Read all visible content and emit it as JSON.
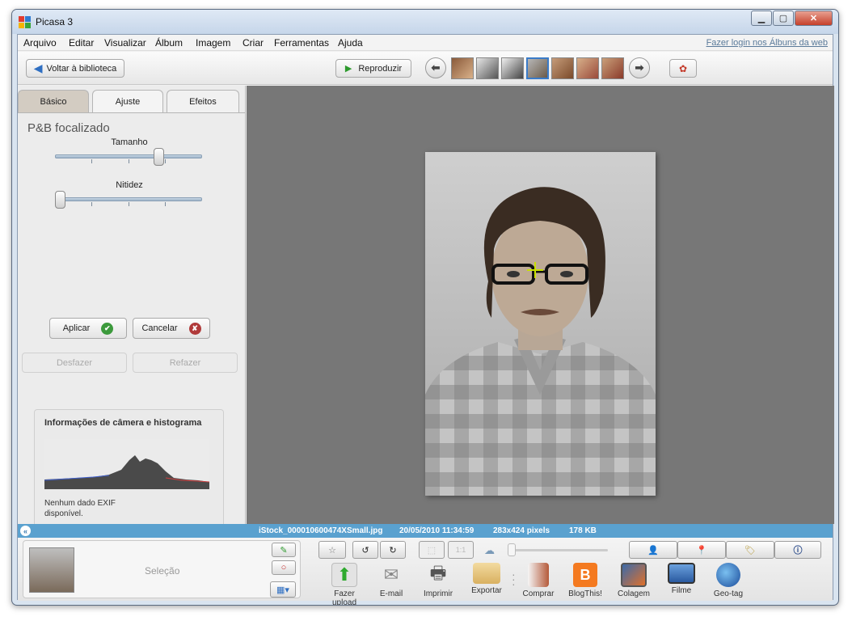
{
  "window": {
    "title": "Picasa 3"
  },
  "menu": {
    "items": [
      "Arquivo",
      "Editar",
      "Visualizar",
      "Álbum",
      "Imagem",
      "Criar",
      "Ferramentas",
      "Ajuda"
    ],
    "login_link": "Fazer login nos Álbuns da web"
  },
  "toolbar": {
    "back_label": "Voltar à biblioteca",
    "play_label": "Reproduzir"
  },
  "tabs": [
    {
      "label": "Básico",
      "active": false
    },
    {
      "label": "Ajuste",
      "active": true
    },
    {
      "label": "Efeitos",
      "active": false
    }
  ],
  "effect": {
    "title": "P&B focalizado",
    "size_label": "Tamanho",
    "size_value": 0.72,
    "sharpness_label": "Nitidez",
    "sharpness_value": 0.0
  },
  "buttons": {
    "apply": "Aplicar",
    "cancel": "Cancelar",
    "undo": "Desfazer",
    "redo": "Refazer"
  },
  "info": {
    "title": "Informações de câmera e histograma",
    "exif_line1": "Nenhum dado EXIF",
    "exif_line2": "disponível."
  },
  "status": {
    "filename": "iStock_000010600474XSmall.jpg",
    "datetime": "20/05/2010 11:34:59",
    "dimensions": "283x424 pixels",
    "size": "178 KB"
  },
  "tray": {
    "selection_label": "Seleção"
  },
  "actions": [
    {
      "label": "Fazer upload",
      "icon": "upload-icon"
    },
    {
      "label": "E-mail",
      "icon": "email-icon"
    },
    {
      "label": "Imprimir",
      "icon": "print-icon"
    },
    {
      "label": "Exportar",
      "icon": "export-folder-icon"
    },
    {
      "label": "Comprar",
      "icon": "shop-icon"
    },
    {
      "label": "BlogThis!",
      "icon": "blogger-icon"
    },
    {
      "label": "Colagem",
      "icon": "collage-icon"
    },
    {
      "label": "Filme",
      "icon": "movie-icon"
    },
    {
      "label": "Geo-tag",
      "icon": "geotag-icon"
    }
  ],
  "colors": {
    "accent": "#5aa1cf",
    "apply_check": "#3c9a3c",
    "cancel_x": "#b03a3a"
  }
}
